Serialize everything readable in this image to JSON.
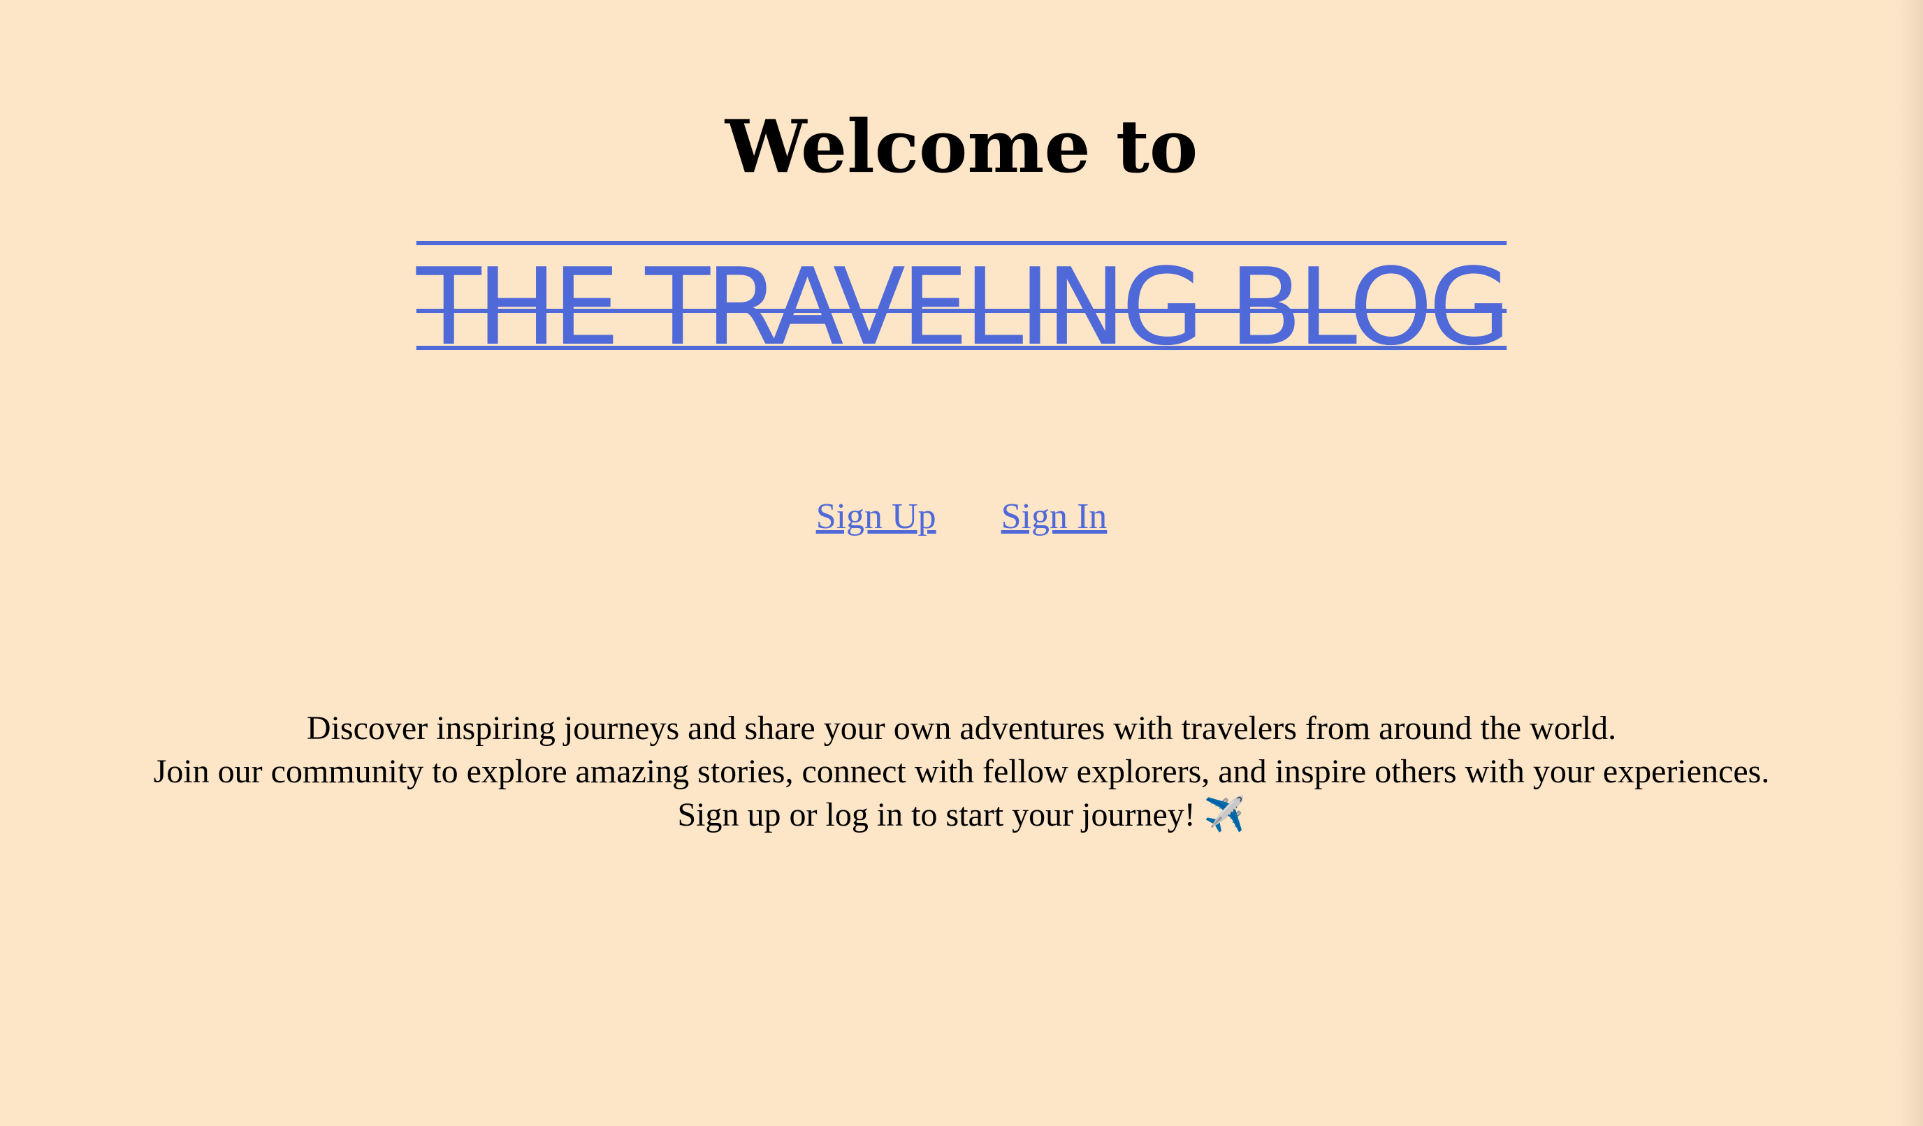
{
  "hero": {
    "welcome": "Welcome to",
    "brand": "THE TRAVELING BLOG"
  },
  "auth": {
    "sign_up": "Sign Up",
    "sign_in": "Sign In"
  },
  "intro": {
    "line1": "Discover inspiring journeys and share your own adventures with travelers from around the world.",
    "line2": "Join our community to explore amazing stories, connect with fellow explorers, and inspire others with your experiences.",
    "line3": "Sign up or log in to start your journey! ✈️"
  },
  "colors": {
    "background": "#fde5c8",
    "brand": "#4f69d8",
    "text": "#000000"
  }
}
